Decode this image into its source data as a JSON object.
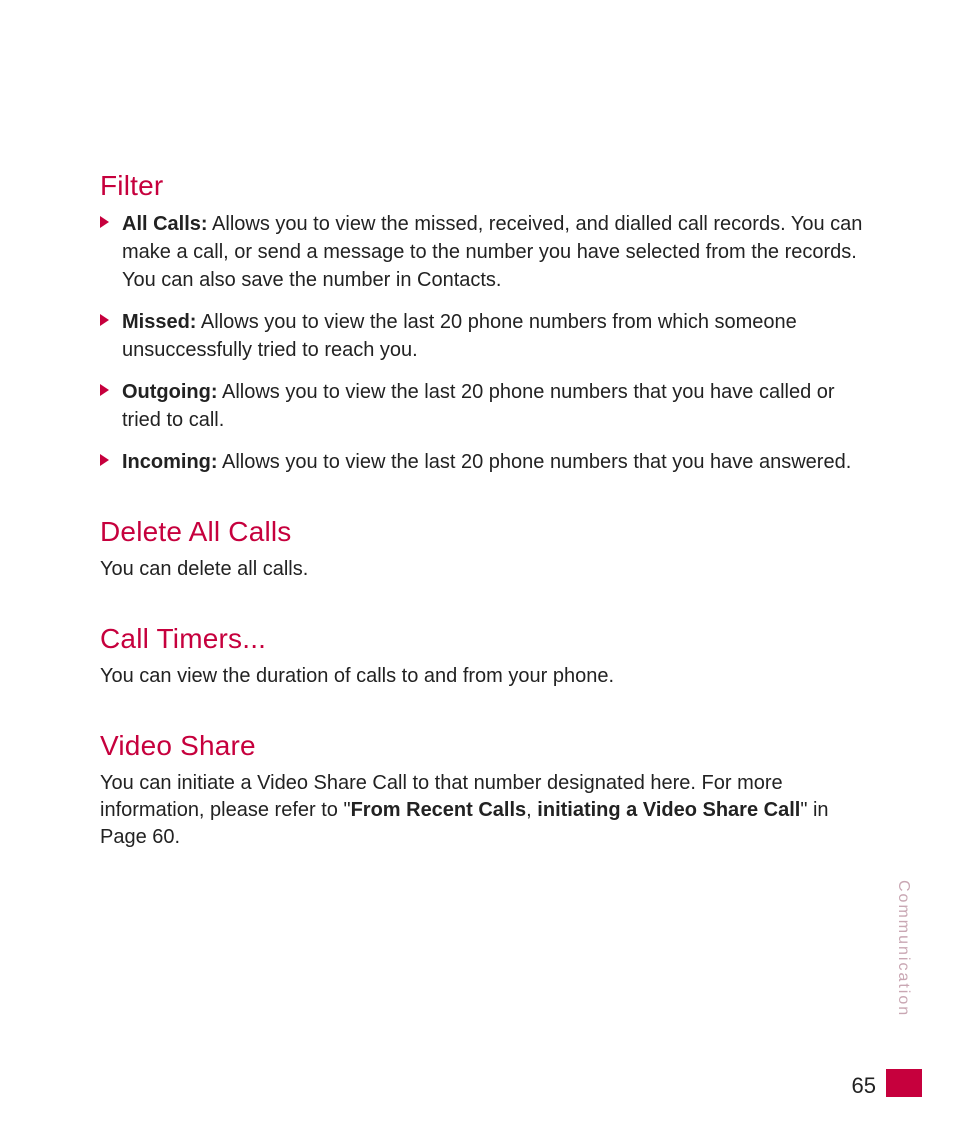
{
  "sections": {
    "filter": {
      "heading": "Filter",
      "items": [
        {
          "label": "All Calls:",
          "text": " Allows you to view the missed, received, and dialled call records. You can make a call, or send a message to the number you have selected from the records. You can also save the number in Contacts."
        },
        {
          "label": "Missed:",
          "text": " Allows you to view the last 20 phone numbers from which someone unsuccessfully tried to reach you."
        },
        {
          "label": "Outgoing:",
          "text": " Allows you to view the last 20 phone numbers that you have called or tried to call."
        },
        {
          "label": "Incoming:",
          "text": " Allows you to view the last 20 phone numbers that you have answered."
        }
      ]
    },
    "deleteAll": {
      "heading": "Delete All Calls",
      "body": "You can delete all calls."
    },
    "callTimers": {
      "heading": "Call Timers...",
      "body": "You can view the duration of calls to and from your phone."
    },
    "videoShare": {
      "heading": "Video Share",
      "leadIn": "You can initiate a Video Share Call to that number designated here. For more information, please refer to \"",
      "bold1": "From Recent Calls",
      "sep": ", ",
      "bold2": "initiating a Video Share Call",
      "tail": "\" in Page 60."
    }
  },
  "sideLabel": "Communication",
  "pageNumber": "65"
}
